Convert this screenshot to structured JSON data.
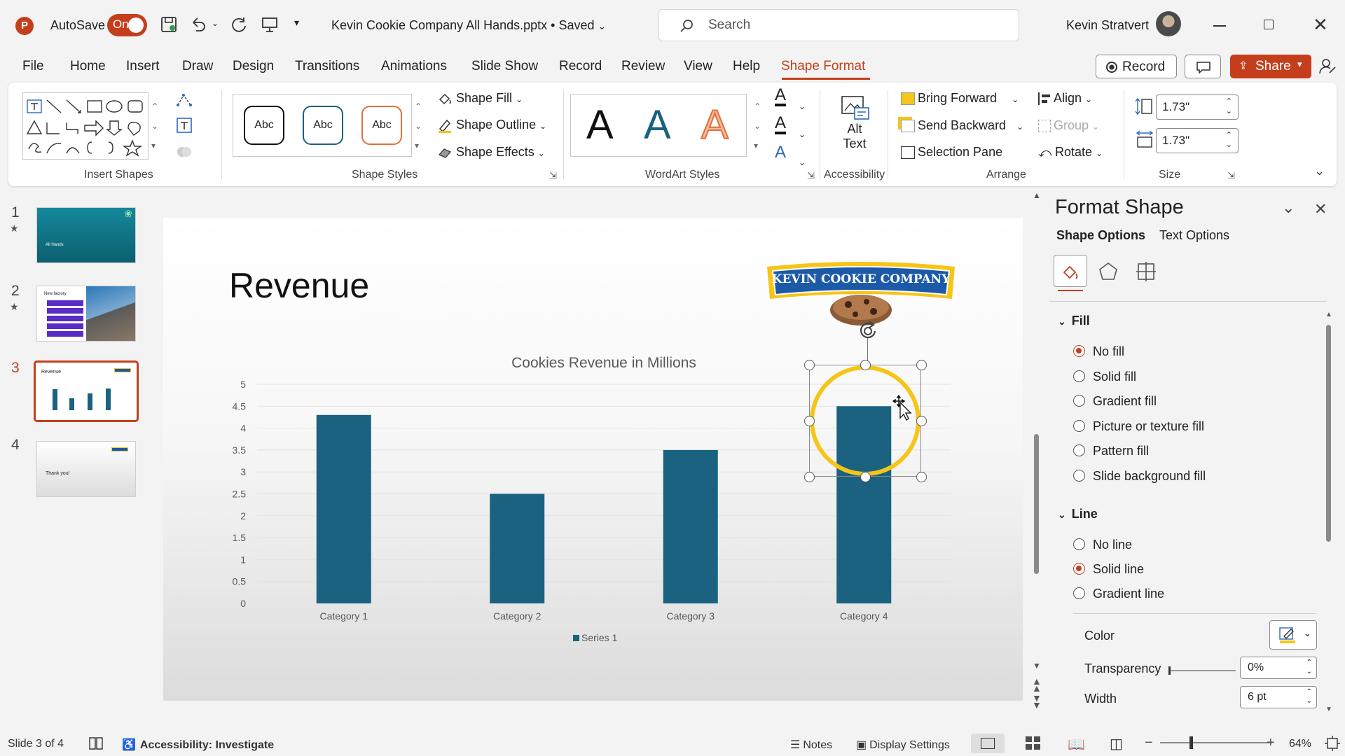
{
  "titlebar": {
    "autosave_label": "AutoSave",
    "autosave_state": "On",
    "filename": "Kevin Cookie Company All Hands.pptx • Saved",
    "search_placeholder": "Search",
    "user_name": "Kevin Stratvert"
  },
  "menu": {
    "items": [
      "File",
      "Home",
      "Insert",
      "Draw",
      "Design",
      "Transitions",
      "Animations",
      "Slide Show",
      "Record",
      "Review",
      "View",
      "Help",
      "Shape Format"
    ],
    "record_button": "Record",
    "share_button": "Share"
  },
  "ribbon": {
    "groups": {
      "insert_shapes": "Insert Shapes",
      "shape_styles": "Shape Styles",
      "wordart_styles": "WordArt Styles",
      "accessibility": "Accessibility",
      "arrange": "Arrange",
      "size": "Size"
    },
    "style_sample": "Abc",
    "shape_fill": "Shape Fill",
    "shape_outline": "Shape Outline",
    "shape_effects": "Shape Effects",
    "wordart_letter": "A",
    "alt_text_1": "Alt",
    "alt_text_2": "Text",
    "bring_forward": "Bring Forward",
    "send_backward": "Send Backward",
    "selection_pane": "Selection Pane",
    "align": "Align",
    "group": "Group",
    "rotate": "Rotate",
    "height": "1.73\"",
    "width": "1.73\""
  },
  "thumbnails": {
    "numbers": [
      "1",
      "2",
      "3",
      "4"
    ],
    "slide1_text": "All Hands",
    "slide2_title": "New factory",
    "slide3_title": "Revenue",
    "slide4_text": "Thank you!"
  },
  "slide": {
    "title": "Revenue",
    "logo_text": "KEVIN COOKIE COMPANY"
  },
  "chart_data": {
    "type": "bar",
    "title": "Cookies Revenue in Millions",
    "categories": [
      "Category 1",
      "Category 2",
      "Category 3",
      "Category 4"
    ],
    "series": [
      {
        "name": "Series 1",
        "values": [
          4.3,
          2.5,
          3.5,
          4.5
        ],
        "color": "#1b6180"
      }
    ],
    "ylim": [
      0,
      5
    ],
    "yticks": [
      "0",
      "0.5",
      "1",
      "1.5",
      "2",
      "2.5",
      "3",
      "3.5",
      "4",
      "4.5",
      "5"
    ],
    "xlabel": "",
    "ylabel": "",
    "grid": true,
    "legend": "bottom"
  },
  "format_pane": {
    "title": "Format Shape",
    "tab_shape": "Shape Options",
    "tab_text": "Text Options",
    "fill_heading": "Fill",
    "fill_options": [
      "No fill",
      "Solid fill",
      "Gradient fill",
      "Picture or texture fill",
      "Pattern fill",
      "Slide background fill"
    ],
    "fill_selected": "No fill",
    "line_heading": "Line",
    "line_options": [
      "No line",
      "Solid line",
      "Gradient line"
    ],
    "line_selected": "Solid line",
    "color_label": "Color",
    "transparency_label": "Transparency",
    "transparency_value": "0%",
    "width_label": "Width",
    "width_value": "6 pt"
  },
  "status": {
    "slide_info": "Slide 3 of 4",
    "accessibility": "Accessibility: Investigate",
    "notes": "Notes",
    "display_settings": "Display Settings",
    "zoom": "64%"
  },
  "colors": {
    "accent": "#c43e1c",
    "bar": "#1b6180",
    "ring": "#f5c518"
  }
}
